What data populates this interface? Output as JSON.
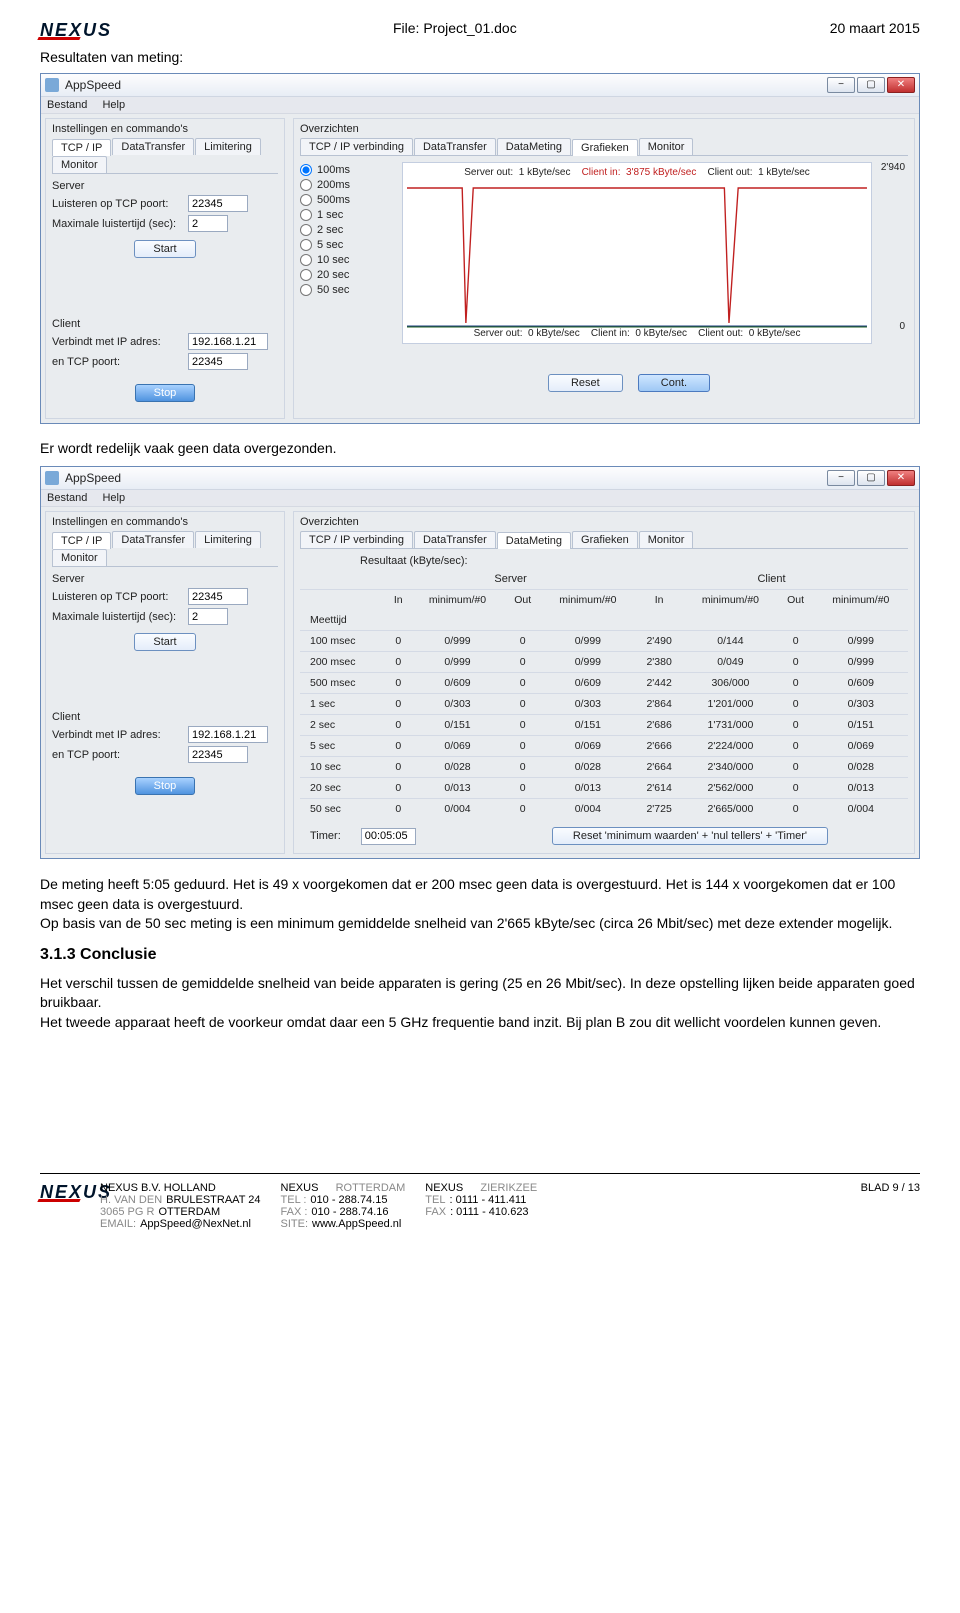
{
  "doc_header": {
    "file": "File: Project_01.doc",
    "date": "20  maart 2015",
    "logo": "NEXUS"
  },
  "section_title": "Resultaten van meting:",
  "app1": {
    "title": "AppSpeed",
    "menu": {
      "file": "Bestand",
      "help": "Help"
    },
    "left": {
      "group": "Instellingen en commando's",
      "tabs": [
        "TCP / IP",
        "DataTransfer",
        "Limitering",
        "Monitor"
      ],
      "server_label": "Server",
      "listen_label": "Luisteren op TCP poort:",
      "listen_val": "22345",
      "maxlisten_label": "Maximale luistertijd (sec):",
      "maxlisten_val": "2",
      "start": "Start",
      "client_label": "Client",
      "connect_label": "Verbindt met IP adres:",
      "connect_val": "192.168.1.21",
      "port_label": "en TCP poort:",
      "port_val": "22345",
      "stop": "Stop"
    },
    "right": {
      "group": "Overzichten",
      "tabs": [
        "TCP / IP verbinding",
        "DataTransfer",
        "DataMeting",
        "Grafieken",
        "Monitor"
      ],
      "active_tab": "Grafieken",
      "radios": [
        "100ms",
        "200ms",
        "500ms",
        "1 sec",
        "2 sec",
        "5 sec",
        "10 sec",
        "20 sec",
        "50 sec"
      ],
      "chart_top": {
        "so_lbl": "Server out:",
        "so_val": "1 kByte/sec",
        "ci_lbl": "Client in:",
        "ci_val": "3'875 kByte/sec",
        "co_lbl": "Client out:",
        "co_val": "1 kByte/sec"
      },
      "chart_btm": {
        "so_lbl": "Server out:",
        "so_val": "0 kByte/sec",
        "ci_lbl": "Client in:",
        "ci_val": "0 kByte/sec",
        "co_lbl": "Client out:",
        "co_val": "0 kByte/sec"
      },
      "ymax": "2'940",
      "ymin": "0",
      "reset": "Reset",
      "cont": "Cont."
    }
  },
  "chart_data": {
    "type": "line",
    "x": [
      0,
      5,
      10,
      12,
      14,
      16,
      70,
      72,
      74,
      76,
      100
    ],
    "series": [
      {
        "name": "Client in",
        "color": "#c02020",
        "values": [
          2940,
          2940,
          2940,
          0,
          2940,
          2940,
          2940,
          0,
          2940,
          2940,
          2940
        ],
        "unit": "kByte/sec"
      },
      {
        "name": "Server out",
        "color": "#204080",
        "values": [
          1,
          1,
          1,
          1,
          1,
          1,
          1,
          1,
          1,
          1,
          1
        ],
        "unit": "kByte/sec"
      },
      {
        "name": "Client out",
        "color": "#206020",
        "values": [
          1,
          1,
          1,
          1,
          1,
          1,
          1,
          1,
          1,
          1,
          1
        ],
        "unit": "kByte/sec"
      }
    ],
    "ylim": [
      0,
      2940
    ],
    "xlabel": "",
    "ylabel": "",
    "title": ""
  },
  "caption1": "Er wordt redelijk vaak geen data overgezonden.",
  "app2": {
    "title": "AppSpeed",
    "menu": {
      "file": "Bestand",
      "help": "Help"
    },
    "right": {
      "group": "Overzichten",
      "tabs": [
        "TCP / IP verbinding",
        "DataTransfer",
        "DataMeting",
        "Grafieken",
        "Monitor"
      ],
      "active_tab": "DataMeting",
      "result_label": "Resultaat (kByte/sec):",
      "server_h": "Server",
      "client_h": "Client",
      "cols": [
        "In",
        "minimum/#0",
        "Out",
        "minimum/#0",
        "In",
        "minimum/#0",
        "Out",
        "minimum/#0"
      ],
      "meettijd": "Meettijd",
      "rows": [
        {
          "l": "100 msec",
          "v": [
            "0",
            "0/999",
            "0",
            "0/999",
            "2'490",
            "0/144",
            "0",
            "0/999"
          ]
        },
        {
          "l": "200 msec",
          "v": [
            "0",
            "0/999",
            "0",
            "0/999",
            "2'380",
            "0/049",
            "0",
            "0/999"
          ]
        },
        {
          "l": "500 msec",
          "v": [
            "0",
            "0/609",
            "0",
            "0/609",
            "2'442",
            "306/000",
            "0",
            "0/609"
          ]
        },
        {
          "l": "1 sec",
          "v": [
            "0",
            "0/303",
            "0",
            "0/303",
            "2'864",
            "1'201/000",
            "0",
            "0/303"
          ]
        },
        {
          "l": "2 sec",
          "v": [
            "0",
            "0/151",
            "0",
            "0/151",
            "2'686",
            "1'731/000",
            "0",
            "0/151"
          ]
        },
        {
          "l": "5 sec",
          "v": [
            "0",
            "0/069",
            "0",
            "0/069",
            "2'666",
            "2'224/000",
            "0",
            "0/069"
          ]
        },
        {
          "l": "10 sec",
          "v": [
            "0",
            "0/028",
            "0",
            "0/028",
            "2'664",
            "2'340/000",
            "0",
            "0/028"
          ]
        },
        {
          "l": "20 sec",
          "v": [
            "0",
            "0/013",
            "0",
            "0/013",
            "2'614",
            "2'562/000",
            "0",
            "0/013"
          ]
        },
        {
          "l": "50 sec",
          "v": [
            "0",
            "0/004",
            "0",
            "0/004",
            "2'725",
            "2'665/000",
            "0",
            "0/004"
          ]
        }
      ],
      "timer_lbl": "Timer:",
      "timer_val": "00:05:05",
      "resetbtn": "Reset 'minimum waarden'  +  'nul tellers'  +  'Timer'"
    }
  },
  "body": {
    "p1": "De meting heeft 5:05 geduurd. Het is 49 x voorgekomen dat er 200 msec geen data is overgestuurd. Het is 144 x voorgekomen dat er 100 msec geen data is overgestuurd.",
    "p2": "Op basis van de 50 sec meting is een minimum gemiddelde snelheid van 2'665 kByte/sec (circa 26 Mbit/sec) met deze extender mogelijk.",
    "h3": "3.1.3   Conclusie",
    "p3": "Het verschil tussen de gemiddelde snelheid van beide apparaten is gering (25 en 26 Mbit/sec). In deze opstelling lijken beide apparaten goed bruikbaar.",
    "p4": "Het tweede apparaat heeft de voorkeur omdat daar een 5 GHz frequentie band inzit. Bij plan B zou dit wellicht voordelen kunnen geven."
  },
  "footer": {
    "logo": "NEXUS",
    "c1": {
      "l1": "NEXUS B.V.  HOLLAND",
      "l2a": "H. VAN DEN",
      "l2b": "BRULESTRAAT 24",
      "l3a": "3065 PG  R",
      "l3b": "OTTERDAM",
      "l4a": "EMAIL:",
      "l4b": "AppSpeed@NexNet.nl"
    },
    "c2": {
      "l1a": "NEXUS",
      "l1b": "ROTTERDAM",
      "l2a": "TEL  :",
      "l2b": "010 - 288.74.15",
      "l3a": "FAX :",
      "l3b": "010 - 288.74.16",
      "l4a": "SITE:",
      "l4b": "www.AppSpeed.nl"
    },
    "c3": {
      "l1a": "NEXUS",
      "l1b": "ZIERIKZEE",
      "l2a": "TEL",
      "l2b": ": 0111 - 411.411",
      "l3a": "FAX",
      "l3b": ": 0111 - 410.623"
    },
    "blad": "BLAD  9 / 13"
  }
}
